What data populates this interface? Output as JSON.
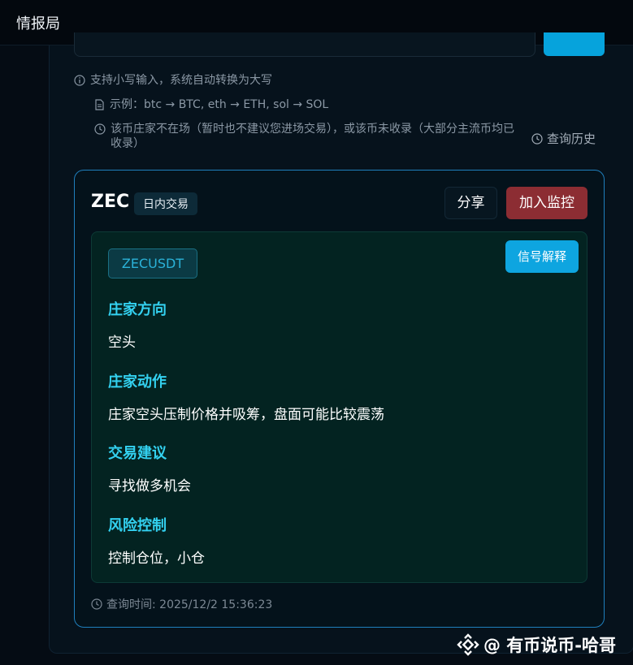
{
  "app": {
    "title": "情报局"
  },
  "hints": {
    "lowercase": "支持小写输入，系统自动转换为大写",
    "example": "示例：btc → BTC, eth → ETH, sol → SOL",
    "not_present": "该币庄家不在场（暂时也不建议您进场交易），或该币未收录（大部分主流币均已收录）",
    "history_label": "查询历史"
  },
  "card": {
    "symbol": "ZEC",
    "tag": "日内交易",
    "share_label": "分享",
    "monitor_label": "加入监控",
    "pair": "ZECUSDT",
    "explain_label": "信号解释",
    "sections": [
      {
        "title": "庄家方向",
        "text": "空头"
      },
      {
        "title": "庄家动作",
        "text": "庄家空头压制价格并吸筹，盘面可能比较震荡"
      },
      {
        "title": "交易建议",
        "text": "寻找做多机会"
      },
      {
        "title": "风险控制",
        "text": "控制仓位，小仓"
      }
    ],
    "query_time": "查询时间: 2025/12/2 15:36:23"
  },
  "watermark": {
    "text": "@ 有币说币-哈哥"
  },
  "colors": {
    "accent": "#0ea5e0",
    "section_title": "#33d1f0",
    "monitor": "#8c2d33",
    "card_border": "#1f7fbd"
  }
}
